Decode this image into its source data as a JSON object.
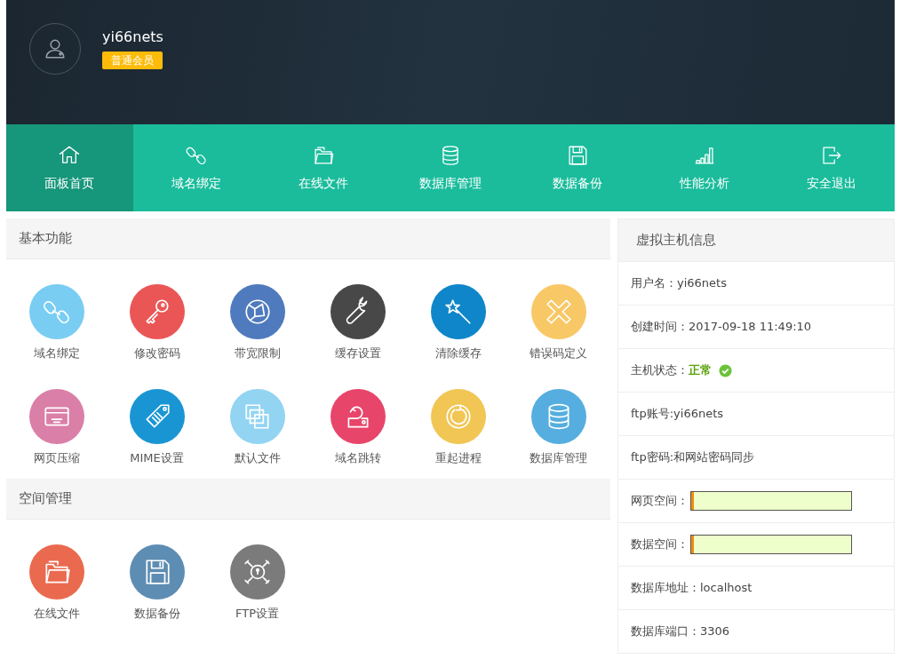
{
  "user": {
    "name": "yi66nets",
    "badge": "普通会员"
  },
  "nav": [
    {
      "label": "面板首页",
      "kind": "home",
      "selected": true
    },
    {
      "label": "域名绑定",
      "kind": "link",
      "selected": false
    },
    {
      "label": "在线文件",
      "kind": "folder",
      "selected": false
    },
    {
      "label": "数据库管理",
      "kind": "database",
      "selected": false
    },
    {
      "label": "数据备份",
      "kind": "disk",
      "selected": false
    },
    {
      "label": "性能分析",
      "kind": "bars",
      "selected": false
    },
    {
      "label": "安全退出",
      "kind": "exit",
      "selected": false
    }
  ],
  "sections": [
    {
      "title": "基本功能",
      "tools": [
        {
          "label": "域名绑定",
          "kind": "link",
          "color": "#79cdf2"
        },
        {
          "label": "修改密码",
          "kind": "key",
          "color": "#ea5656"
        },
        {
          "label": "带宽限制",
          "kind": "globe",
          "color": "#4f7abd"
        },
        {
          "label": "缓存设置",
          "kind": "wrench",
          "color": "#484848"
        },
        {
          "label": "清除缓存",
          "kind": "wand",
          "color": "#0f86c9"
        },
        {
          "label": "错误码定义",
          "kind": "cross",
          "color": "#f8c867"
        },
        {
          "label": "网页压缩",
          "kind": "card",
          "color": "#da7fa8"
        },
        {
          "label": "MIME设置",
          "kind": "tag",
          "color": "#1a95d4"
        },
        {
          "label": "默认文件",
          "kind": "pages",
          "color": "#92d4f2"
        },
        {
          "label": "域名跳转",
          "kind": "redirect",
          "color": "#e8456b"
        },
        {
          "label": "重起进程",
          "kind": "restart",
          "color": "#f1c655"
        },
        {
          "label": "数据库管理",
          "kind": "database",
          "color": "#55aedf"
        }
      ]
    },
    {
      "title": "空间管理",
      "tools": [
        {
          "label": "在线文件",
          "kind": "folder",
          "color": "#ea6a4f"
        },
        {
          "label": "数据备份",
          "kind": "disk",
          "color": "#5e8db3"
        },
        {
          "label": "FTP设置",
          "kind": "lock",
          "color": "#7b7b7b"
        }
      ]
    }
  ],
  "info": {
    "title": "虚拟主机信息",
    "rows": [
      {
        "kind": "text",
        "label": "用户名：yi66nets"
      },
      {
        "kind": "text",
        "label": "创建时间：2017-09-18 11:49:10"
      },
      {
        "kind": "status",
        "label": "主机状态：",
        "value": "正常",
        "ok": true
      },
      {
        "kind": "text",
        "label": "ftp账号:yi66nets"
      },
      {
        "kind": "text",
        "label": "ftp密码:和网站密码同步"
      },
      {
        "kind": "meter",
        "label": "网页空间：",
        "level": 0.01
      },
      {
        "kind": "meter",
        "label": "数据空间：",
        "level": 0.01
      },
      {
        "kind": "text",
        "label": "数据库地址：localhost"
      },
      {
        "kind": "text",
        "label": "数据库端口：3306"
      }
    ]
  }
}
